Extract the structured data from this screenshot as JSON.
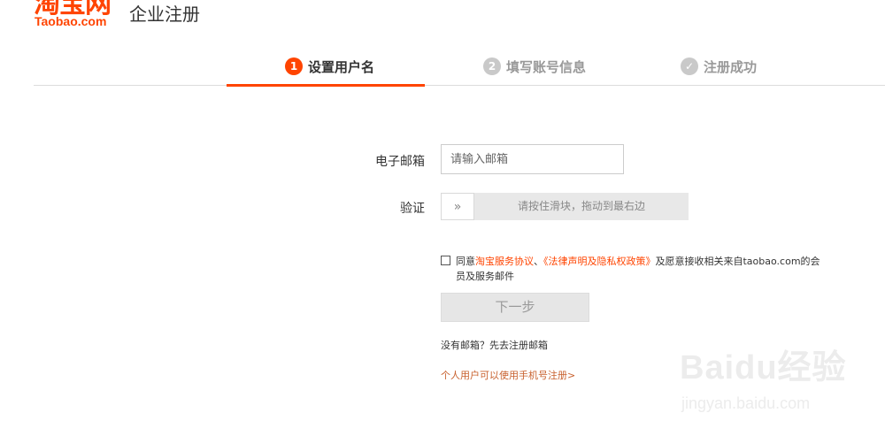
{
  "header": {
    "logo_cn": "淘宝网",
    "logo_en": "Taobao.com",
    "title": "企业注册"
  },
  "steps": [
    {
      "num": "1",
      "label": "设置用户名",
      "state": "active"
    },
    {
      "num": "2",
      "label": "填写账号信息",
      "state": "inactive"
    },
    {
      "num": "✓",
      "label": "注册成功",
      "state": "inactive"
    }
  ],
  "form": {
    "email_label": "电子邮箱",
    "email_placeholder": "请输入邮箱",
    "email_value": "",
    "verify_label": "验证",
    "slider_handle_icon": "double-chevron-right-icon",
    "slider_handle_glyph": "»",
    "slider_hint": "请按住滑块，拖动到最右边"
  },
  "agreement": {
    "checked": false,
    "prefix": "同意",
    "link1": "淘宝服务协议",
    "sep": "、",
    "link2": "《法律声明及隐私权政策》",
    "suffix": "及愿意接收相关来自taobao.com的会员及服务邮件"
  },
  "next_button": "下一步",
  "no_email_text": "没有邮箱？先去注册邮箱",
  "phone_register_link": "个人用户可以使用手机号注册>",
  "watermark": {
    "main": "Baidu经验",
    "sub": "jingyan.baidu.com"
  },
  "colors": {
    "accent": "#ff4400",
    "link": "#c8612e",
    "step_inactive": "#c9c9c9"
  }
}
